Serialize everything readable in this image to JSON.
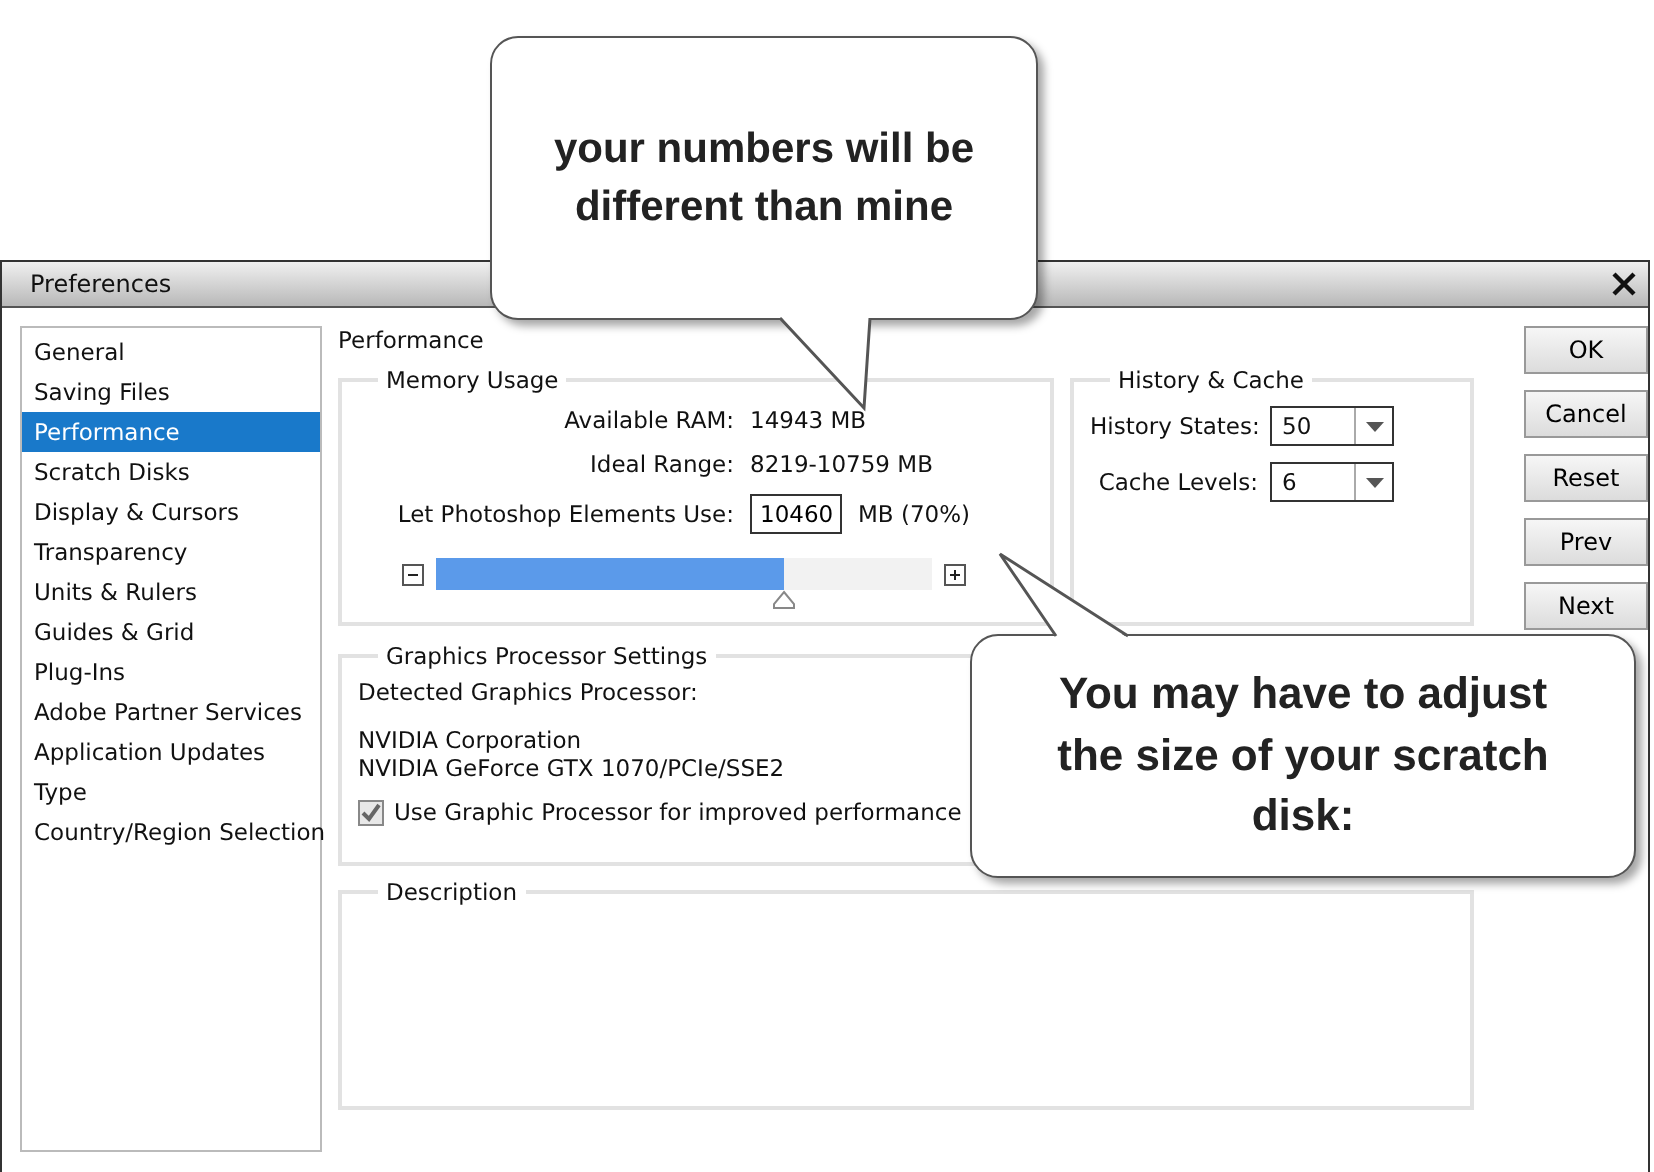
{
  "window": {
    "title": "Preferences"
  },
  "sidebar": {
    "items": [
      {
        "label": "General",
        "selected": false
      },
      {
        "label": "Saving Files",
        "selected": false
      },
      {
        "label": "Performance",
        "selected": true
      },
      {
        "label": "Scratch Disks",
        "selected": false
      },
      {
        "label": "Display & Cursors",
        "selected": false
      },
      {
        "label": "Transparency",
        "selected": false
      },
      {
        "label": "Units & Rulers",
        "selected": false
      },
      {
        "label": "Guides & Grid",
        "selected": false
      },
      {
        "label": "Plug-Ins",
        "selected": false
      },
      {
        "label": "Adobe Partner Services",
        "selected": false
      },
      {
        "label": "Application Updates",
        "selected": false
      },
      {
        "label": "Type",
        "selected": false
      },
      {
        "label": "Country/Region Selection",
        "selected": false
      }
    ]
  },
  "panel_title": "Performance",
  "memory_usage": {
    "title": "Memory Usage",
    "rows": [
      {
        "label": "Available RAM:",
        "value": "14943 MB"
      },
      {
        "label": "Ideal Range:",
        "value": "8219-10759 MB"
      }
    ],
    "use_label": "Let Photoshop Elements Use:",
    "use_value": "10460",
    "use_suffix": "MB (70%)",
    "level": 0.7
  },
  "history_cache": {
    "title": "History & Cache",
    "fields": [
      {
        "label": "History States:",
        "value": "50"
      },
      {
        "label": "Cache Levels:",
        "value": "6"
      }
    ]
  },
  "buttons": [
    {
      "label": "OK"
    },
    {
      "label": "Cancel"
    },
    {
      "label": "Reset"
    },
    {
      "label": "Prev"
    },
    {
      "label": "Next"
    }
  ],
  "graphics": {
    "title": "Graphics Processor Settings",
    "detected_label": "Detected Graphics Processor:",
    "vendor": "NVIDIA Corporation",
    "renderer": "NVIDIA GeForce GTX 1070/PCIe/SSE2",
    "checkbox": {
      "label": "Use Graphic Processor for improved performance",
      "checked": true
    }
  },
  "description": {
    "title": "Description"
  },
  "callouts": [
    {
      "text": "your numbers will be different than mine"
    },
    {
      "text": "You may have to adjust the size of your scratch disk:"
    }
  ]
}
